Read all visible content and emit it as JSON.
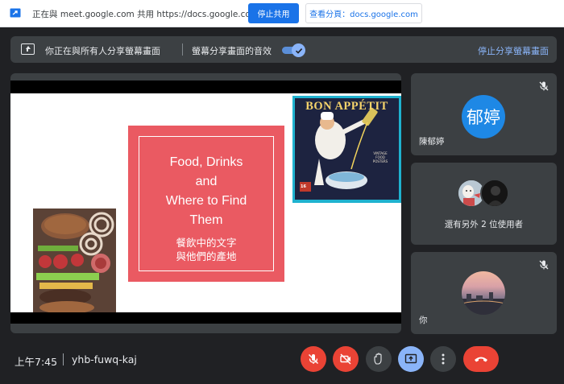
{
  "sharebar": {
    "message": "正在與 meet.google.com 共用 https://docs.google.com",
    "stop_button": "停止共用",
    "view_button": "查看分頁：docs.google.com"
  },
  "banner": {
    "presenting_text": "你正在與所有人分享螢幕畫面",
    "audio_text": "螢幕分享畫面的音效",
    "audio_enabled": true,
    "stop_link": "停止分享螢幕畫面"
  },
  "slide": {
    "title": "Food, Drinks\nand\nWhere to Find\nThem",
    "subtitle": "餐飲中的文字\n與他們的產地",
    "poster_title": "BON APPÉTIT",
    "poster_subtitle": "VINTAGE\nFOOD\nPOSTERS",
    "poster_badge": "16",
    "accent_color": "#ea5a62"
  },
  "participants": [
    {
      "initials": "郁婷",
      "name": "陳郁婷",
      "muted": true,
      "avatar_color": "#1e88e5"
    },
    {
      "others_label": "還有另外 2 位使用者"
    },
    {
      "name": "你",
      "muted": true
    }
  ],
  "footer": {
    "time": "上午7:45",
    "meeting_code": "yhb-fuwq-kaj",
    "controls": [
      "mic-off",
      "camera-off",
      "raise-hand",
      "present",
      "more",
      "leave-call"
    ]
  }
}
